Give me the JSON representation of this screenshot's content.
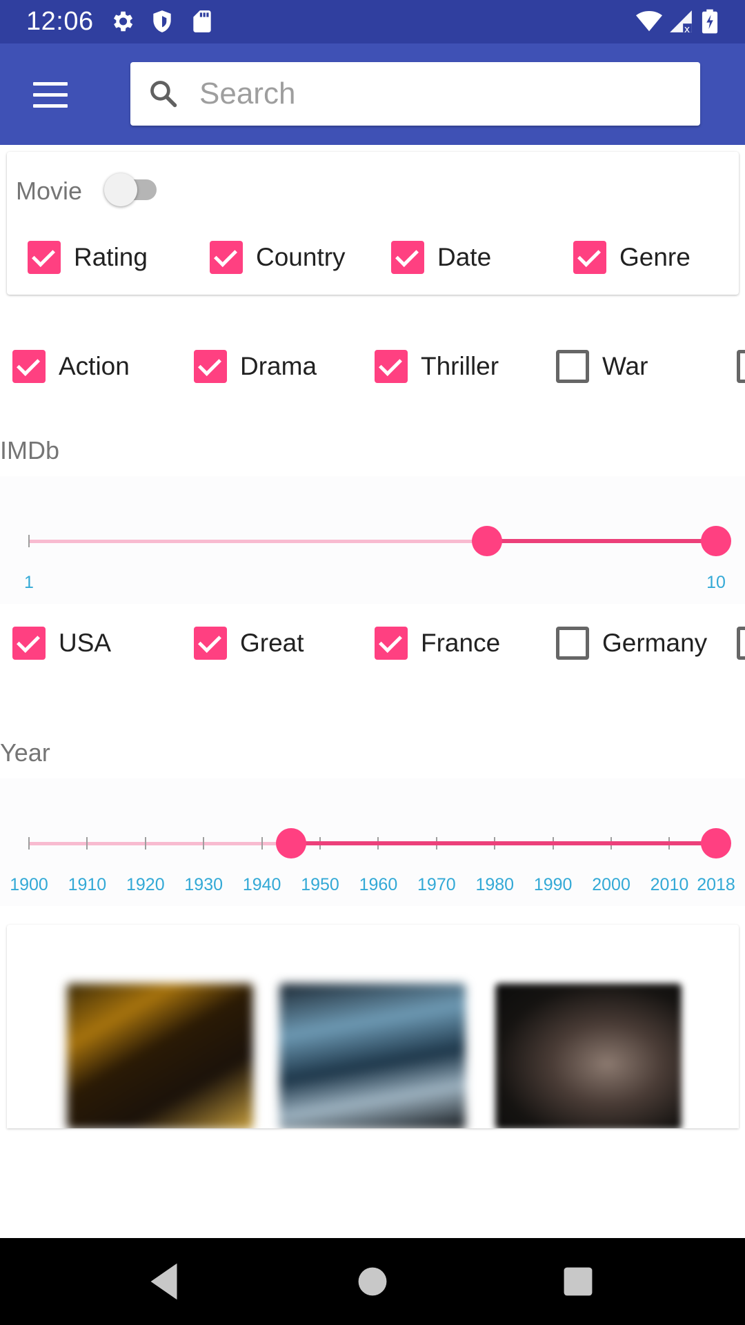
{
  "status_bar": {
    "time": "12:06",
    "icons": [
      "settings-icon",
      "shield-icon",
      "sd-card-icon",
      "wifi-icon",
      "signal-icon",
      "battery-icon"
    ]
  },
  "app_bar": {
    "menu_icon": "hamburger-menu-icon",
    "search": {
      "placeholder": "Search",
      "value": ""
    }
  },
  "filter_card": {
    "movie_label": "Movie",
    "movie_switch_on": false,
    "options": [
      {
        "label": "Rating",
        "checked": true
      },
      {
        "label": "Country",
        "checked": true
      },
      {
        "label": "Date",
        "checked": true
      },
      {
        "label": "Genre",
        "checked": true
      }
    ]
  },
  "genres": [
    {
      "label": "Action",
      "checked": true
    },
    {
      "label": "Drama",
      "checked": true
    },
    {
      "label": "Thriller",
      "checked": true
    },
    {
      "label": "War",
      "checked": false
    }
  ],
  "imdb": {
    "label": "IMDb",
    "min": 1,
    "max": 10,
    "selected_low": 7,
    "selected_high": 10,
    "tick_labels": [
      "1",
      "10"
    ]
  },
  "countries": [
    {
      "label": "USA",
      "checked": true
    },
    {
      "label": "Great",
      "checked": true
    },
    {
      "label": "France",
      "checked": true
    },
    {
      "label": "Germany",
      "checked": false
    }
  ],
  "year": {
    "label": "Year",
    "min": 1900,
    "max": 2018,
    "selected_low": 1945,
    "selected_high": 2018,
    "tick_labels": [
      "1900",
      "1910",
      "1920",
      "1930",
      "1940",
      "1950",
      "1960",
      "1970",
      "1980",
      "1990",
      "2000",
      "2010",
      "2018"
    ]
  },
  "posters": [
    "movie-poster-1",
    "movie-poster-2",
    "movie-poster-3"
  ],
  "nav_bar": {
    "icons": [
      "back-icon",
      "home-icon",
      "recents-icon"
    ]
  },
  "colors": {
    "primary": "#3f51b5",
    "primary_dark": "#303f9f",
    "accent": "#ff4081",
    "tick_label": "#33a9d6"
  }
}
